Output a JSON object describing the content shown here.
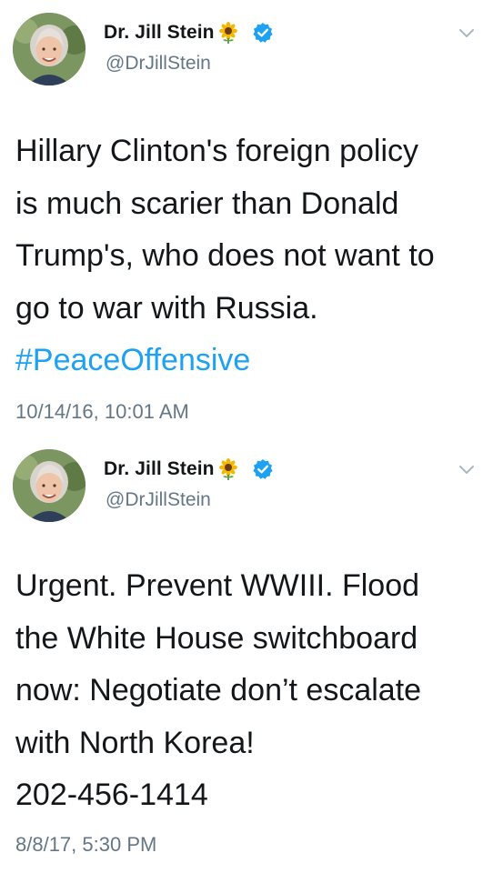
{
  "tweets": [
    {
      "author": {
        "display_name": "Dr. Jill Stein",
        "name_emoji": "sunflower-icon",
        "handle": "@DrJillStein",
        "verified": true
      },
      "text_lines": [
        "Hillary Clinton's foreign policy",
        "is much scarier than Donald",
        "Trump's, who does not want to",
        "go to war with Russia."
      ],
      "hashtag": "#PeaceOffensive",
      "timestamp": "10/14/16, 10:01 AM"
    },
    {
      "author": {
        "display_name": "Dr. Jill Stein",
        "name_emoji": "sunflower-icon",
        "handle": "@DrJillStein",
        "verified": true
      },
      "text_lines": [
        "Urgent. Prevent WWIII. Flood",
        "the White House switchboard",
        "now: Negotiate don’t escalate",
        "with North Korea!",
        "202-456-1414"
      ],
      "timestamp": "8/8/17, 5:30 PM"
    }
  ],
  "colors": {
    "text": "#14171a",
    "secondary": "#657786",
    "link": "#1da1f2",
    "verified": "#1da1f2",
    "caret": "#aab8c2"
  }
}
